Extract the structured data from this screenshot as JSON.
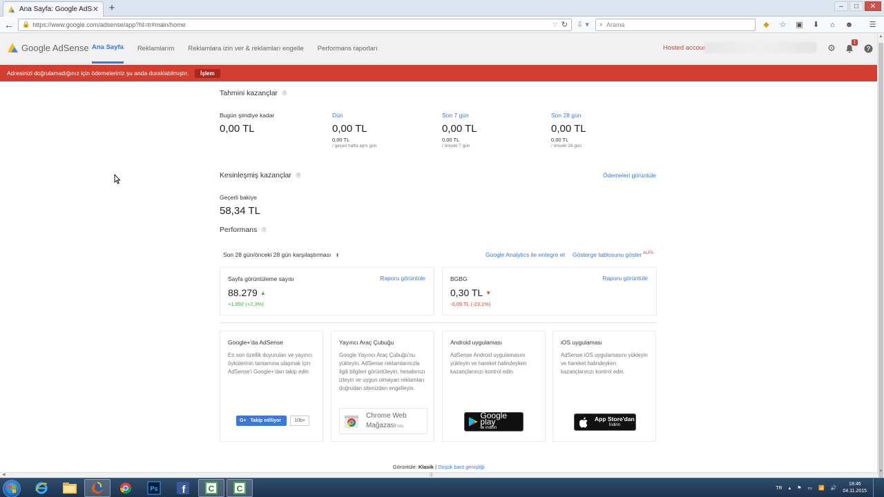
{
  "browser": {
    "tab_title": "Ana Sayfa: Google AdSense",
    "url": "https://www.google.com/adsense/app?hl=tr#main/home",
    "search_placeholder": "Arama"
  },
  "header": {
    "logo_text": "Google AdSense",
    "nav": [
      "Ana Sayfa",
      "Reklamlarım",
      "Reklamlara izin ver & reklamları engelle",
      "Performans raporları"
    ],
    "hosted_account": "Hosted accour",
    "notification_count": "1",
    "colors": {
      "accent": "#3c78d8",
      "alert": "#d23f31",
      "positive": "#46a346"
    }
  },
  "alert": {
    "message": "Adresinizi doğrulamadığınız için ödemeleriniz şu anda duraklatılmıştır.",
    "action": "İşlem"
  },
  "estimated": {
    "title": "Tahmini kazançlar",
    "items": [
      {
        "label": "Bugün şimdiye kadar",
        "value": "0,00 TL",
        "sub_value": "",
        "sub_label": ""
      },
      {
        "label": "Dün",
        "value": "0,00 TL",
        "sub_value": "0,00 TL",
        "sub_label": "/ geçen hafta aynı gün"
      },
      {
        "label": "Son 7 gün",
        "value": "0,00 TL",
        "sub_value": "0,00 TL",
        "sub_label": "/ önceki 7 gün"
      },
      {
        "label": "Son 28 gün",
        "value": "0,00 TL",
        "sub_value": "0,00 TL",
        "sub_label": "/ önceki 28 gün"
      }
    ]
  },
  "finalized": {
    "title": "Kesinleşmiş kazançlar",
    "view_payments": "Ödemeleri görüntüle",
    "balance_label": "Geçerli bakiye",
    "balance_value": "58,34 TL"
  },
  "performance": {
    "title": "Performans",
    "comparison": "Son 28 gün/önceki 28 gün karşılaştırması",
    "analytics_link": "Google Analytics ile entegre et",
    "dashboard_link": "Gösterge tablosunu göster",
    "alfa": "ALFA",
    "cards": [
      {
        "title": "Sayfa görüntüleme sayısı",
        "link": "Raporu görüntüle",
        "value": "88.279",
        "delta": "+1.992 (+2,3%)"
      },
      {
        "title": "BGBG",
        "link": "Raporu görüntüle",
        "value": "0,30 TL",
        "delta": "-0,09 TL (-23,1%)"
      }
    ]
  },
  "promos": [
    {
      "title": "Google+'da AdSense",
      "body": "En son özellik duyuruları ve yayıncı öykülerinin tamamına ulaşmak için AdSense'i Google+'dan takip edin.",
      "follow": "Takip ediliyor",
      "count": "10b+"
    },
    {
      "title": "Yayıncı Araç Çubuğu",
      "body": "Google Yayıncı Araç Çubuğu'nu yükleyin. AdSense reklamlarınızla ilgili bilgileri görüntüleyin, hesabınızı izleyin ve uygun olmayan reklamları doğrudan sitenizden engelleyin.",
      "store_line1": "Chrome Web",
      "store_line2": "Mağazası",
      "store_suffix": "'nda"
    },
    {
      "title": "Android uygulaması",
      "body": "AdSense Android uygulamasını yükleyin ve hareket halindeyken kazançlarınızı kontrol edin.",
      "store_big": "Google play",
      "store_small": "ile indirin"
    },
    {
      "title": "iOS uygulaması",
      "body": "AdSense iOS uygulamasını yükleyin ve hareket halindeyken kazançlarınızı kontrol edin.",
      "store_big": "App Store'dan",
      "store_small": "İndirin"
    }
  ],
  "footer": {
    "prefix": "Görüntüle: ",
    "current": "Klasik",
    "sep": " | ",
    "alt": "Düşük bant genişliği"
  },
  "taskbar": {
    "lang": "TR",
    "time": "18:46",
    "date": "04.11.2015"
  }
}
